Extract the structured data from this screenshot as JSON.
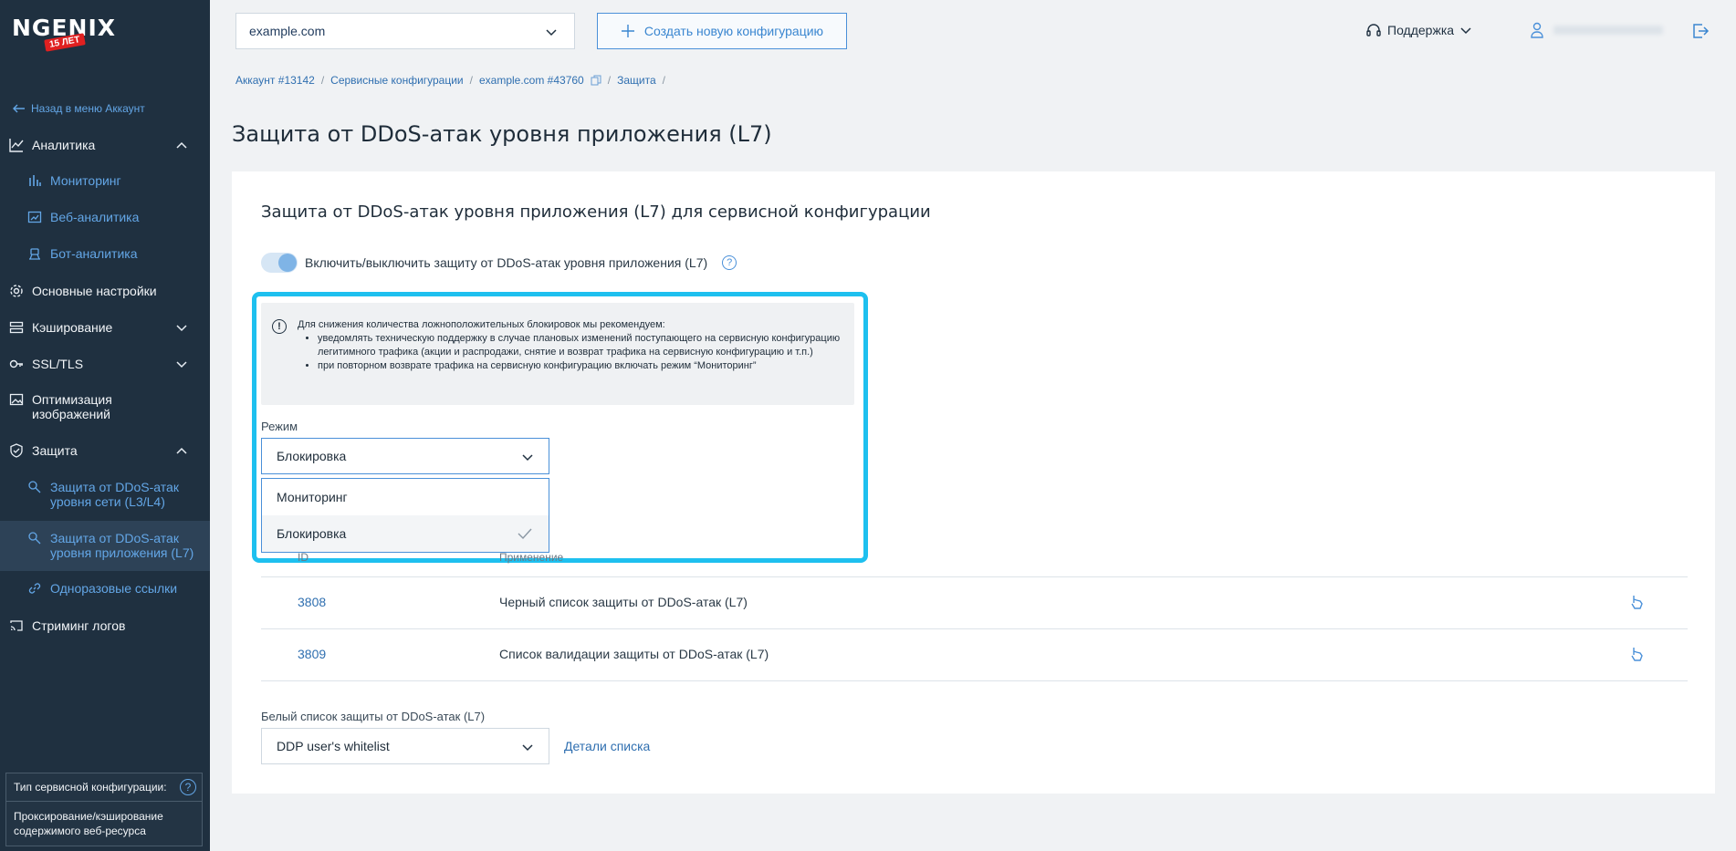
{
  "sidebar": {
    "logo": "NGENIX",
    "logo_badge": "15 ЛЕТ",
    "back": "Назад в меню Аккаунт",
    "analytics": "Аналитика",
    "monitoring": "Мониторинг",
    "web_analytics": "Веб-аналитика",
    "bot_analytics": "Бот-аналитика",
    "basic_settings": "Основные настройки",
    "caching": "Кэширование",
    "ssl": "SSL/TLS",
    "image_opt_1": "Оптимизация",
    "image_opt_2": "изображений",
    "protection": "Защита",
    "ddos_l34_1": "Защита от DDoS-атак",
    "ddos_l34_2": "уровня сети (L3/L4)",
    "ddos_l7_1": "Защита от DDoS-атак",
    "ddos_l7_2": "уровня приложения (L7)",
    "one_time_links": "Одноразовые ссылки",
    "log_streaming": "Стриминг логов",
    "config_type_label": "Тип сервисной конфигурации:",
    "config_type_value_1": "Проксирование/кэширование",
    "config_type_value_2": "содержимого веб-ресурса"
  },
  "header": {
    "domain": "example.com",
    "create_button": "Создать новую конфигурацию",
    "support": "Поддержка"
  },
  "breadcrumb": {
    "account": "Аккаунт #13142",
    "service_configs": "Сервисные конфигурации",
    "config": "example.com #43760",
    "protection": "Защита"
  },
  "page": {
    "title": "Защита от DDoS-атак уровня приложения (L7)",
    "card_title": "Защита от DDoS-атак уровня приложения (L7) для сервисной конфигурации",
    "toggle_label": "Включить/выключить защиту от DDoS-атак уровня приложения (L7)",
    "info_intro": "Для снижения количества ложноположительных блокировок мы рекомендуем:",
    "info_item_1": "уведомлять техническую поддержку в случае плановых изменений поступающего на сервисную конфигурацию легитимного трафика (акции и распродажи, снятие и возврат трафика на сервисную конфигурацию и т.п.)",
    "info_item_2": "при повторном возврате трафика на сервисную конфигурацию включать режим “Мониторинг”",
    "mode_label": "Режим",
    "mode_value": "Блокировка",
    "mode_options": [
      "Мониторинг",
      "Блокировка"
    ],
    "col_id": "ID",
    "col_apply": "Применение",
    "rows": [
      {
        "id": "3808",
        "name": "Черный список защиты от DDoS-атак (L7)"
      },
      {
        "id": "3809",
        "name": "Список валидации защиты от DDoS-атак (L7)"
      }
    ],
    "whitelist_label": "Белый список защиты от DDoS-атак (L7)",
    "whitelist_value": "DDP user's whitelist",
    "whitelist_link": "Детали списка"
  },
  "colors": {
    "sidebar_bg": "#1f3040",
    "accent": "#4a90d9",
    "highlight": "#1ec0ef"
  }
}
